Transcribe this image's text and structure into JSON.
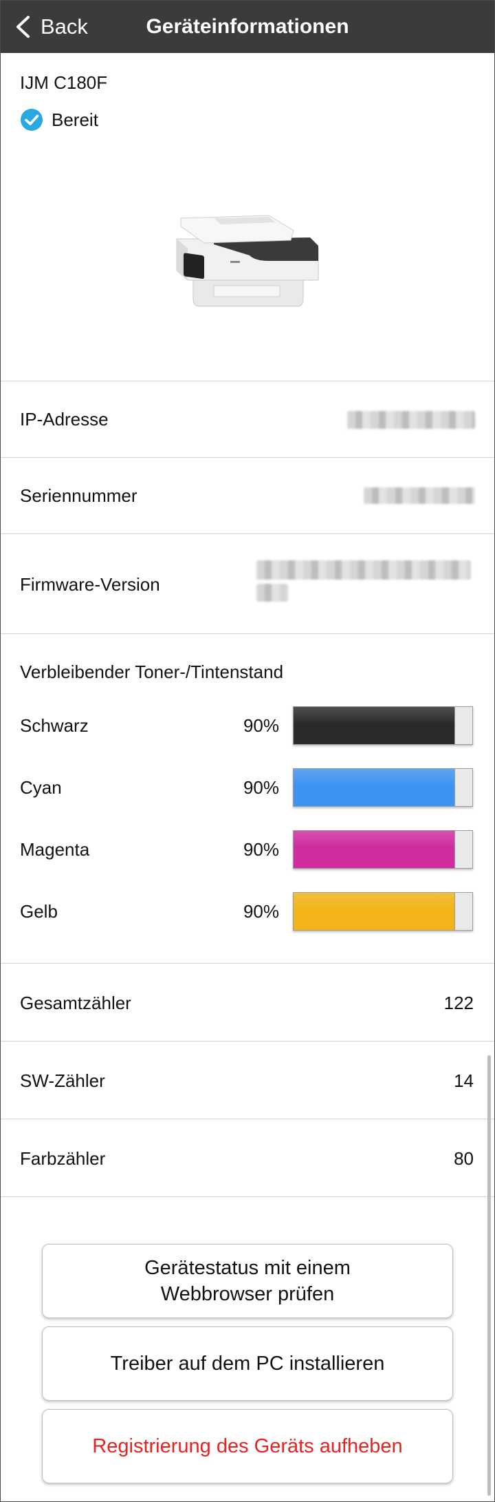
{
  "nav": {
    "back_label": "Back",
    "title": "Geräteinformationen"
  },
  "device": {
    "model": "IJM C180F",
    "status": "Bereit",
    "status_color": "#2aa8e0"
  },
  "info": {
    "ip_label": "IP-Adresse",
    "serial_label": "Seriennummer",
    "firmware_label": "Firmware-Version"
  },
  "ink": {
    "title": "Verbleibender Toner-/Tintenstand",
    "levels": [
      {
        "name": "Schwarz",
        "percent_text": "90%",
        "level": 0.9,
        "color": "#2a2a2a"
      },
      {
        "name": "Cyan",
        "percent_text": "90%",
        "level": 0.9,
        "color": "#3d94f0"
      },
      {
        "name": "Magenta",
        "percent_text": "90%",
        "level": 0.9,
        "color": "#d02b9f"
      },
      {
        "name": "Gelb",
        "percent_text": "90%",
        "level": 0.9,
        "color": "#f2b418"
      }
    ]
  },
  "counters": [
    {
      "label": "Gesamtzähler",
      "value": "122"
    },
    {
      "label": "SW-Zähler",
      "value": "14"
    },
    {
      "label": "Farbzähler",
      "value": "80"
    }
  ],
  "buttons": {
    "webbrowser_line1": "Gerätestatus mit einem",
    "webbrowser_line2": "Webbrowser prüfen",
    "install_driver": "Treiber auf dem PC installieren",
    "unregister": "Registrierung des Geräts aufheben",
    "unregister_color": "#e8221f"
  }
}
